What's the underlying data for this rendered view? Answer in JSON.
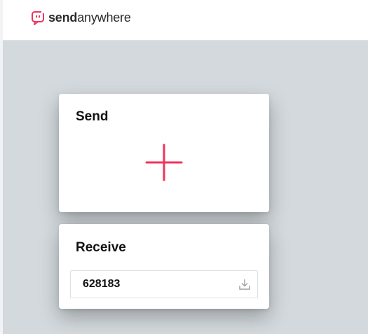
{
  "app": {
    "brand_strong": "send",
    "brand_light": "anywhere",
    "logo_icon": "chat-bubble-logo-icon",
    "accent_color": "#f0335e"
  },
  "send": {
    "title": "Send",
    "add_icon": "plus-icon"
  },
  "receive": {
    "title": "Receive",
    "key_value": "628183",
    "download_icon": "download-icon"
  }
}
